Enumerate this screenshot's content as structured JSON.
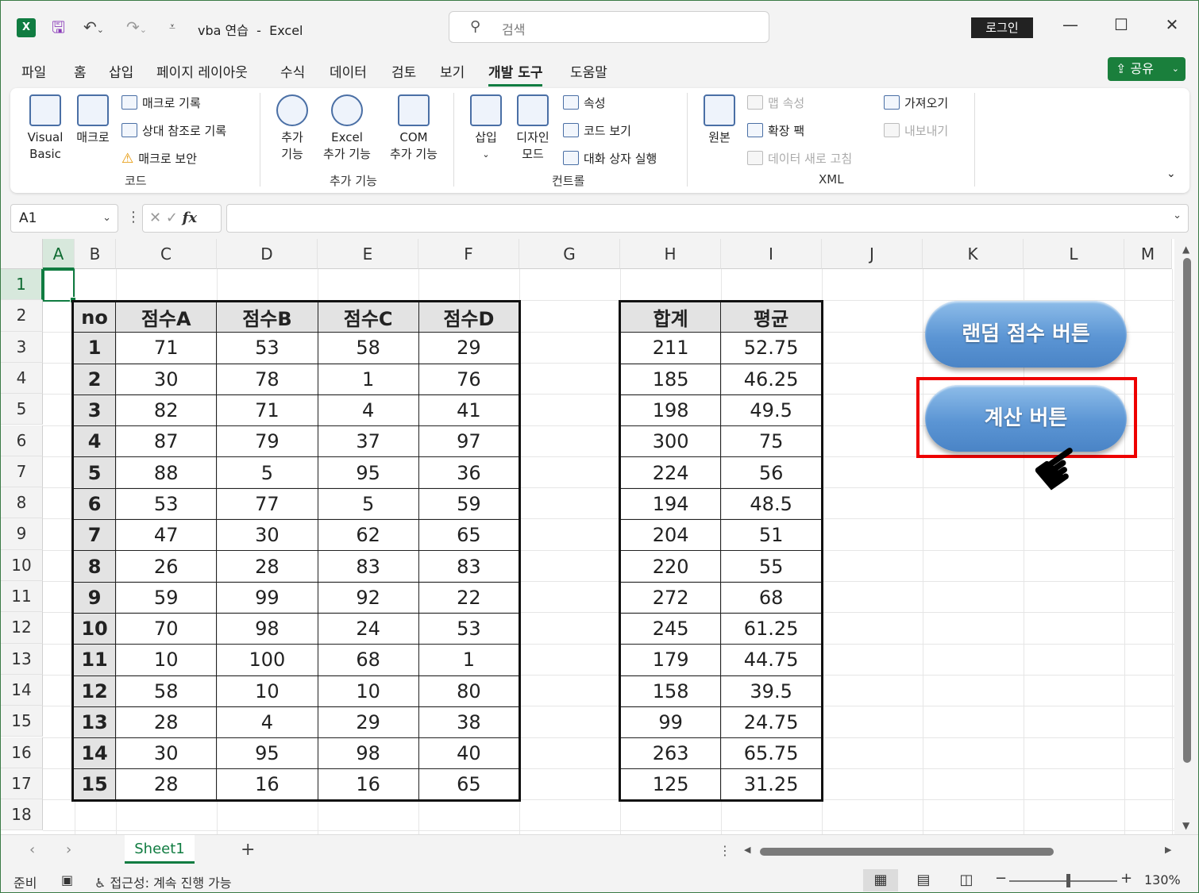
{
  "title": {
    "doc": "vba 연습",
    "sep": "-",
    "app": "Excel",
    "search_placeholder": "검색",
    "login": "로그인"
  },
  "menu": [
    "파일",
    "홈",
    "삽입",
    "페이지 레이아웃",
    "수식",
    "데이터",
    "검토",
    "보기",
    "개발 도구",
    "도움말"
  ],
  "share": "공유",
  "ribbon": {
    "code": {
      "visual_basic_1": "Visual",
      "visual_basic_2": "Basic",
      "macro": "매크로",
      "record": "매크로 기록",
      "relative": "상대 참조로 기록",
      "security": "매크로 보안",
      "label": "코드"
    },
    "addins": {
      "addin_1": "추가",
      "addin_2": "기능",
      "excel_1": "Excel",
      "excel_2": "추가 기능",
      "com_1": "COM",
      "com_2": "추가 기능",
      "label": "추가 기능"
    },
    "controls": {
      "insert": "삽입",
      "design_1": "디자인",
      "design_2": "모드",
      "properties": "속성",
      "view_code": "코드 보기",
      "run_dialog": "대화 상자 실행",
      "label": "컨트롤"
    },
    "xml": {
      "source": "원본",
      "map_props": "맵 속성",
      "expansion": "확장 팩",
      "refresh": "데이터 새로 고침",
      "import": "가져오기",
      "export": "내보내기",
      "label": "XML"
    }
  },
  "formula": {
    "name_box": "A1",
    "fx": "fx",
    "value": ""
  },
  "columns": [
    "A",
    "B",
    "C",
    "D",
    "E",
    "F",
    "G",
    "H",
    "I",
    "J",
    "K",
    "L",
    "M"
  ],
  "rows": [
    "1",
    "2",
    "3",
    "4",
    "5",
    "6",
    "7",
    "8",
    "9",
    "10",
    "11",
    "12",
    "13",
    "14",
    "15",
    "16",
    "17",
    "18"
  ],
  "scores": {
    "headers": [
      "no",
      "점수A",
      "점수B",
      "점수C",
      "점수D"
    ],
    "rows": [
      [
        "1",
        "71",
        "53",
        "58",
        "29"
      ],
      [
        "2",
        "30",
        "78",
        "1",
        "76"
      ],
      [
        "3",
        "82",
        "71",
        "4",
        "41"
      ],
      [
        "4",
        "87",
        "79",
        "37",
        "97"
      ],
      [
        "5",
        "88",
        "5",
        "95",
        "36"
      ],
      [
        "6",
        "53",
        "77",
        "5",
        "59"
      ],
      [
        "7",
        "47",
        "30",
        "62",
        "65"
      ],
      [
        "8",
        "26",
        "28",
        "83",
        "83"
      ],
      [
        "9",
        "59",
        "99",
        "92",
        "22"
      ],
      [
        "10",
        "70",
        "98",
        "24",
        "53"
      ],
      [
        "11",
        "10",
        "100",
        "68",
        "1"
      ],
      [
        "12",
        "58",
        "10",
        "10",
        "80"
      ],
      [
        "13",
        "28",
        "4",
        "29",
        "38"
      ],
      [
        "14",
        "30",
        "95",
        "98",
        "40"
      ],
      [
        "15",
        "28",
        "16",
        "16",
        "65"
      ]
    ]
  },
  "summary": {
    "headers": [
      "합계",
      "평균"
    ],
    "rows": [
      [
        "211",
        "52.75"
      ],
      [
        "185",
        "46.25"
      ],
      [
        "198",
        "49.5"
      ],
      [
        "300",
        "75"
      ],
      [
        "224",
        "56"
      ],
      [
        "194",
        "48.5"
      ],
      [
        "204",
        "51"
      ],
      [
        "220",
        "55"
      ],
      [
        "272",
        "68"
      ],
      [
        "245",
        "61.25"
      ],
      [
        "179",
        "44.75"
      ],
      [
        "158",
        "39.5"
      ],
      [
        "99",
        "24.75"
      ],
      [
        "263",
        "65.75"
      ],
      [
        "125",
        "31.25"
      ]
    ]
  },
  "buttons": {
    "random": "랜덤 점수 버튼",
    "calc": "계산 버튼"
  },
  "sheet_tab": "Sheet1",
  "status": {
    "ready": "준비",
    "accessibility": "접근성: 계속 진행 가능",
    "zoom": "130%"
  }
}
